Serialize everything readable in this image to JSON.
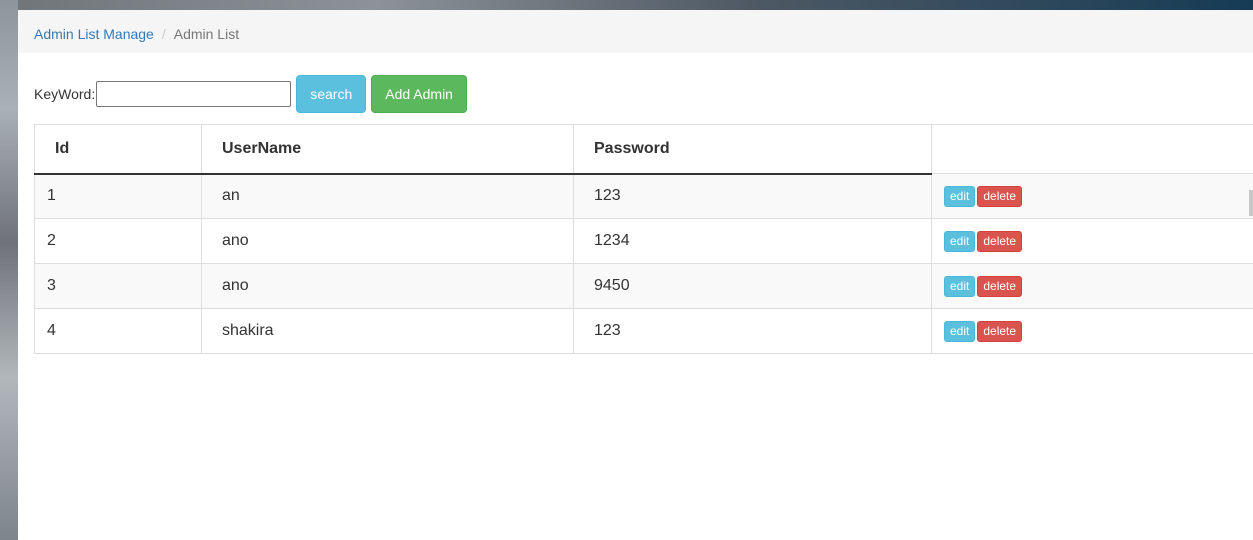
{
  "breadcrumb": {
    "parent": "Admin List Manage",
    "separator": "/",
    "current": "Admin List"
  },
  "toolbar": {
    "keyword_label": "KeyWord:",
    "keyword_value": "",
    "search_label": "search",
    "add_label": "Add Admin"
  },
  "table": {
    "headers": [
      "Id",
      "UserName",
      "Password",
      ""
    ],
    "rows": [
      {
        "id": "1",
        "username": "an",
        "password": "123"
      },
      {
        "id": "2",
        "username": "ano",
        "password": "1234"
      },
      {
        "id": "3",
        "username": "ano",
        "password": "9450"
      },
      {
        "id": "4",
        "username": "shakira",
        "password": "123"
      }
    ],
    "edit_label": "edit",
    "delete_label": "delete"
  },
  "colors": {
    "link": "#337ab7",
    "info": "#5bc0de",
    "success": "#5cb85c",
    "danger": "#d9534f"
  }
}
